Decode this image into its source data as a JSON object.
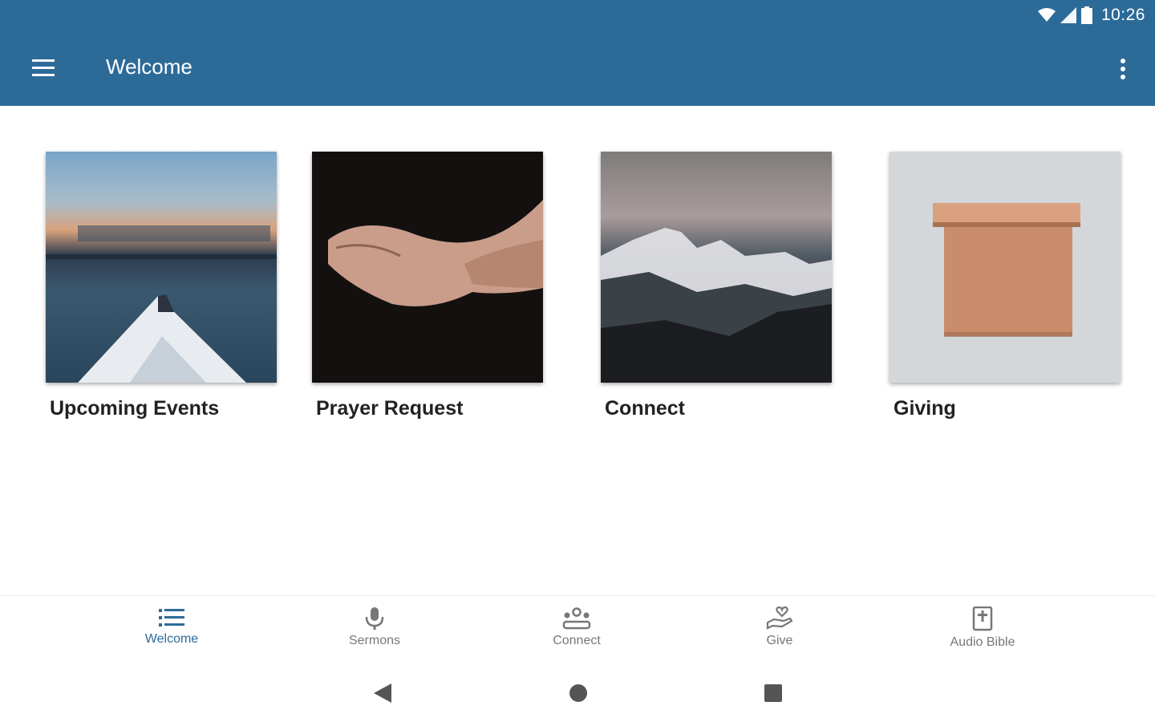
{
  "status_bar": {
    "time": "10:26"
  },
  "app_bar": {
    "title": "Welcome"
  },
  "cards": [
    {
      "label": "Upcoming Events"
    },
    {
      "label": "Prayer Request"
    },
    {
      "label": "Connect"
    },
    {
      "label": "Giving"
    }
  ],
  "bottom_nav": {
    "tabs": [
      {
        "label": "Welcome",
        "icon": "list-icon",
        "active": true
      },
      {
        "label": "Sermons",
        "icon": "microphone-icon",
        "active": false
      },
      {
        "label": "Connect",
        "icon": "group-icon",
        "active": false
      },
      {
        "label": "Give",
        "icon": "give-hand-icon",
        "active": false
      },
      {
        "label": "Audio Bible",
        "icon": "bible-icon",
        "active": false
      }
    ]
  },
  "colors": {
    "primary": "#2c6b98",
    "inactive": "#777777"
  }
}
